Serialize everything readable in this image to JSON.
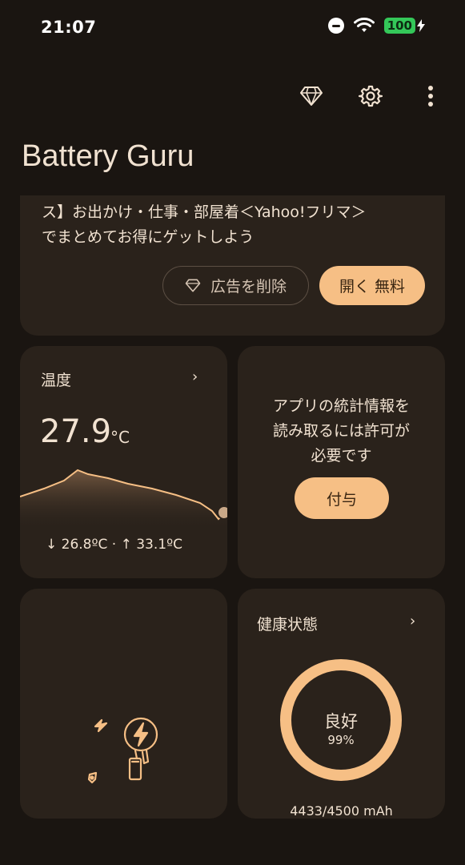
{
  "status_bar": {
    "time": "21:07",
    "battery_level": "100",
    "icons": [
      "do-not-disturb-icon",
      "wifi-icon",
      "battery-charging-icon"
    ]
  },
  "toolbar": {
    "icons": [
      "premium-diamond-icon",
      "settings-gear-icon",
      "more-vert-icon"
    ]
  },
  "app_title": "Battery Guru",
  "ad": {
    "text_line1": "ス】お出かけ・仕事・部屋着＜Yahoo!フリマ＞",
    "text_line2": "でまとめてお得にゲットしよう",
    "remove_ads_label": "広告を削除",
    "open_label": "開く 無料"
  },
  "temperature": {
    "label": "温度",
    "value": "27.9",
    "unit": "°C",
    "min_max": "↓ 26.8ºC · ↑ 33.1ºC"
  },
  "permission": {
    "line1": "アプリの統計情報を",
    "line2": "読み取るには許可が",
    "line3": "必要です",
    "grant_label": "付与"
  },
  "health": {
    "label": "健康状態",
    "status": "良好",
    "percent": "99%",
    "capacity": "4433/4500 mAh",
    "level": 0.99
  },
  "colors": {
    "background": "#1a1511",
    "card": "#2a221b",
    "accent": "#f6bf85",
    "text": "#f1e2d1"
  }
}
